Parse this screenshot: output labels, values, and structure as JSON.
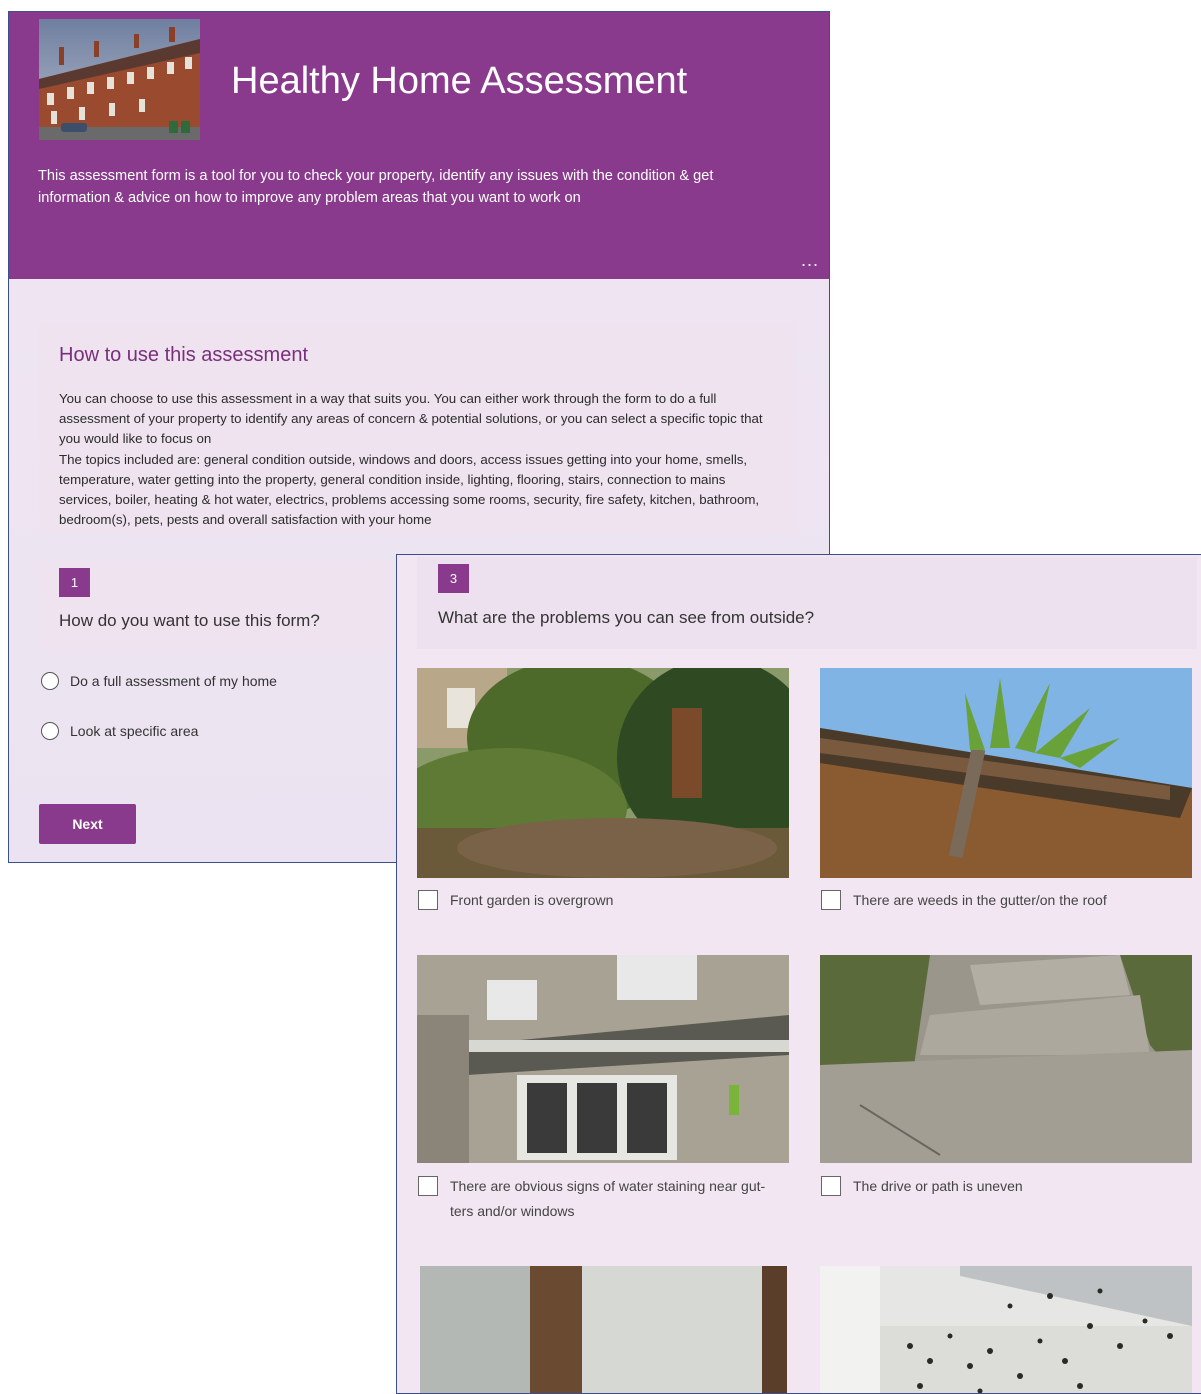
{
  "form": {
    "title": "Healthy Home Assessment",
    "description": "This assessment form is a tool for you to check your property, identify any issues with the condition & get information & advice on how to improve any problem areas that you want to work on",
    "more_label": "...",
    "accent_color": "#8a3a8c"
  },
  "intro": {
    "title": "How to use this assessment",
    "body": "You can choose to use this assessment in a way that suits you. You can either work through the form to do a full assessment of your property to identify any areas of concern & potential solutions, or you can select a specific topic that you would like to focus on\nThe topics included are: general condition outside, windows and doors, access issues getting into your home, smells, temperature, water getting into the property, general condition inside, lighting, flooring, stairs, connection to mains services, boiler, heating & hot water, electrics, problems accessing some rooms, security, fire safety, kitchen, bathroom, bedroom(s), pets, pests and overall satisfaction with your home"
  },
  "question1": {
    "number": "1",
    "text": "How do you want to use this form?",
    "options": [
      "Do a full assessment of my home",
      "Look at specific area"
    ]
  },
  "next_label": "Next",
  "question3": {
    "number": "3",
    "text": "What are the problems you can see from outside?",
    "options": [
      "Front garden is overgrown",
      "There are weeds in the gutter/on the roof",
      "There are obvious signs of water staining near gut-\nters and/or windows",
      "The drive or path is uneven"
    ]
  }
}
